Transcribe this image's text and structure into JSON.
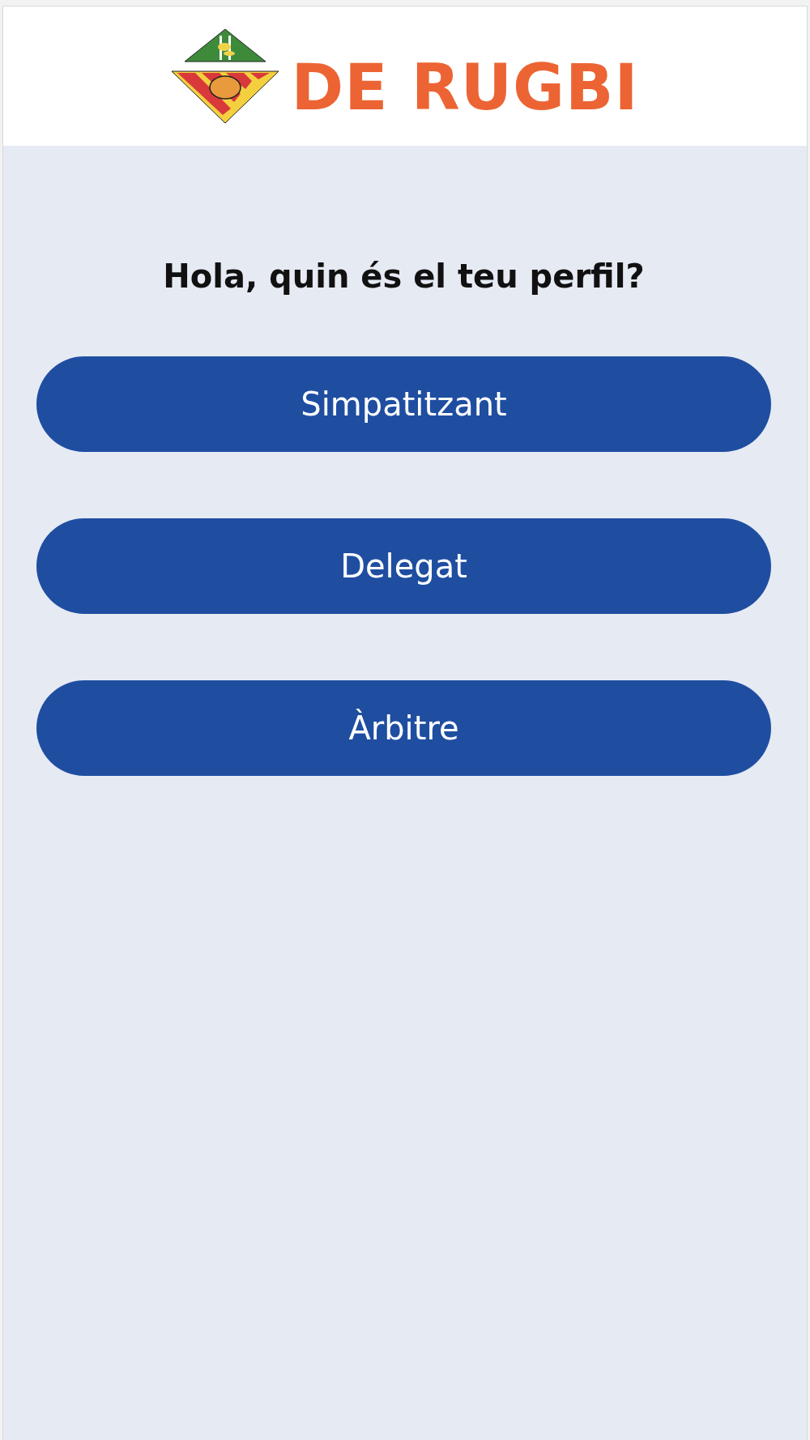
{
  "header": {
    "brand": "DE RUGBI"
  },
  "question": "Hola, quin és el teu perfil?",
  "profiles": [
    {
      "label": "Simpatitzant"
    },
    {
      "label": "Delegat"
    },
    {
      "label": "Àrbitre"
    }
  ]
}
